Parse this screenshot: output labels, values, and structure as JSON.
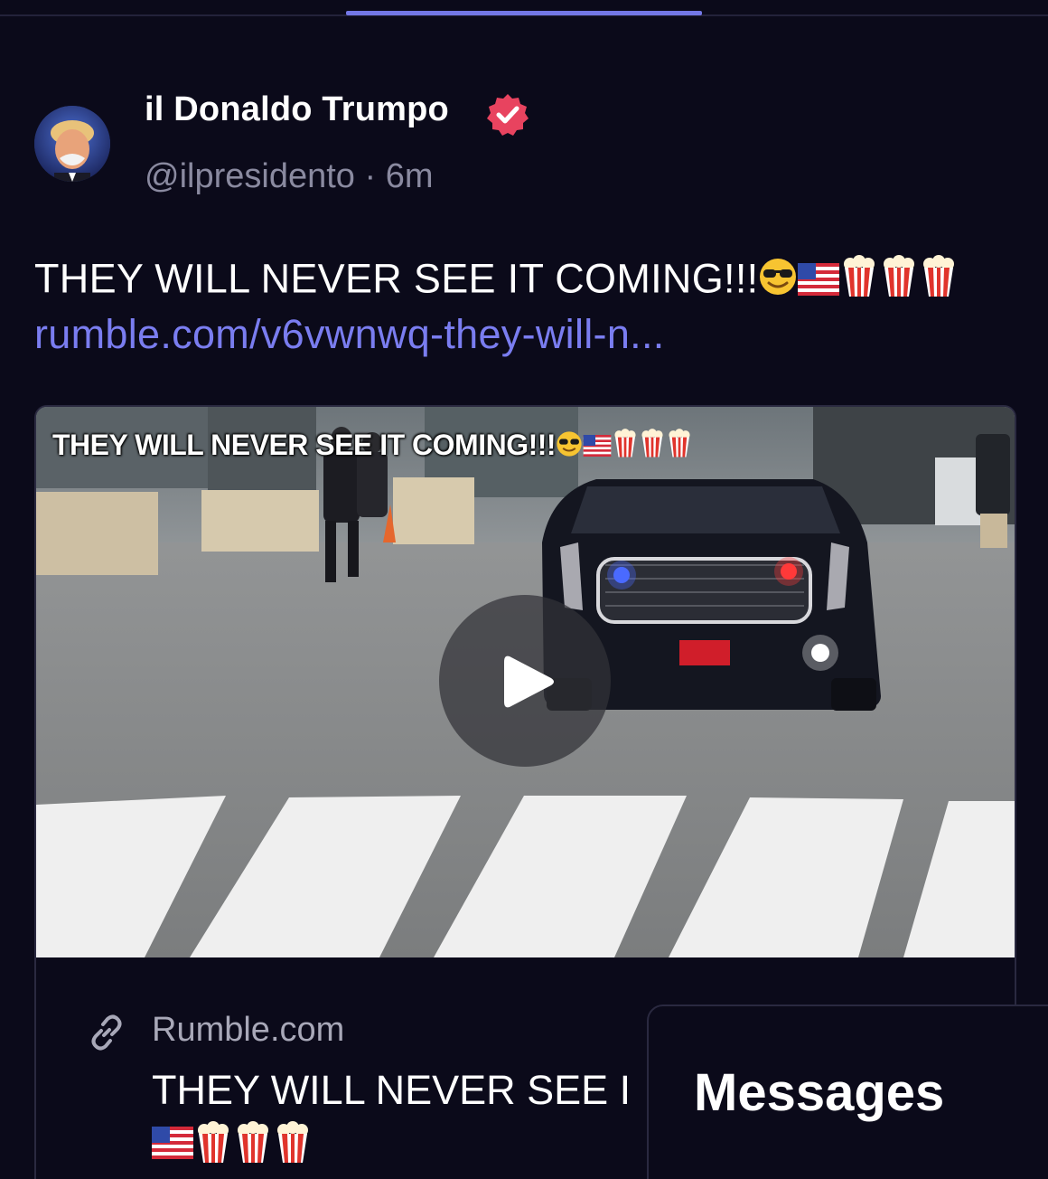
{
  "header": {
    "author_name": "il Donaldo Trumpo",
    "handle": "@ilpresidento",
    "separator": "·",
    "time": "6m"
  },
  "post": {
    "text": "THEY WILL NEVER SEE IT COMING!!!",
    "link": "rumble.com/v6vwnwq-they-will-n..."
  },
  "card": {
    "video_title": "THEY WILL NEVER SEE IT COMING!!!",
    "source": "Rumble.com",
    "title": "THEY WILL NEVER SEE I"
  },
  "messages": {
    "title": "Messages"
  },
  "colors": {
    "background": "#0b0a1a",
    "accent": "#7377e6",
    "link": "#7a7df0",
    "muted": "#8a8aa0",
    "verified": "#e8435f"
  },
  "icons": {
    "verified": "verified-badge-icon",
    "link": "link-icon",
    "play": "play-icon",
    "emoji": [
      "sunglasses-emoji",
      "us-flag-emoji",
      "popcorn-emoji",
      "popcorn-emoji",
      "popcorn-emoji"
    ]
  }
}
